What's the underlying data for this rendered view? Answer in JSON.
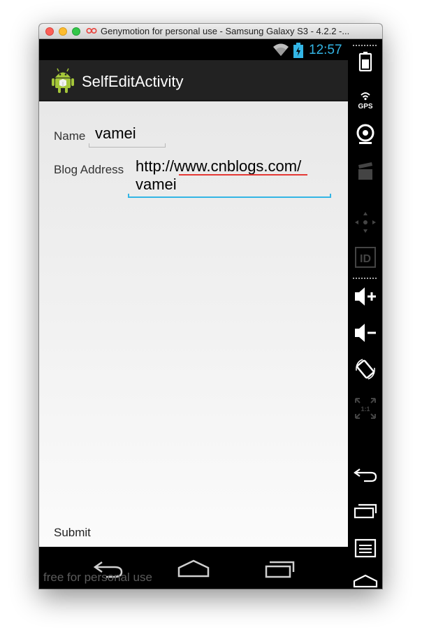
{
  "window": {
    "title": "Genymotion for personal use - Samsung Galaxy S3 - 4.2.2 -..."
  },
  "statusbar": {
    "time": "12:57"
  },
  "actionbar": {
    "title": "SelfEditActivity"
  },
  "form": {
    "name_label": "Name",
    "name_value": "vamei",
    "blog_label": "Blog Address",
    "blog_value": "http://www.cnblogs.com/ vamei",
    "submit_label": "Submit"
  },
  "watermark": "free for personal use",
  "sidebar": {
    "gps_label": "GPS",
    "id_label": "ID",
    "scale_label": "1:1",
    "items": [
      "battery-icon",
      "gps-icon",
      "webcam-icon",
      "clapper-icon",
      "dpad-icon",
      "id-icon",
      "volume-up-icon",
      "volume-down-icon",
      "rotate-icon",
      "scale-icon",
      "back-icon",
      "recent-apps-icon",
      "menu-icon",
      "home-icon"
    ]
  },
  "colors": {
    "accent": "#33b5e5",
    "actionbar": "#222222",
    "spellcheck": "#e53935"
  }
}
